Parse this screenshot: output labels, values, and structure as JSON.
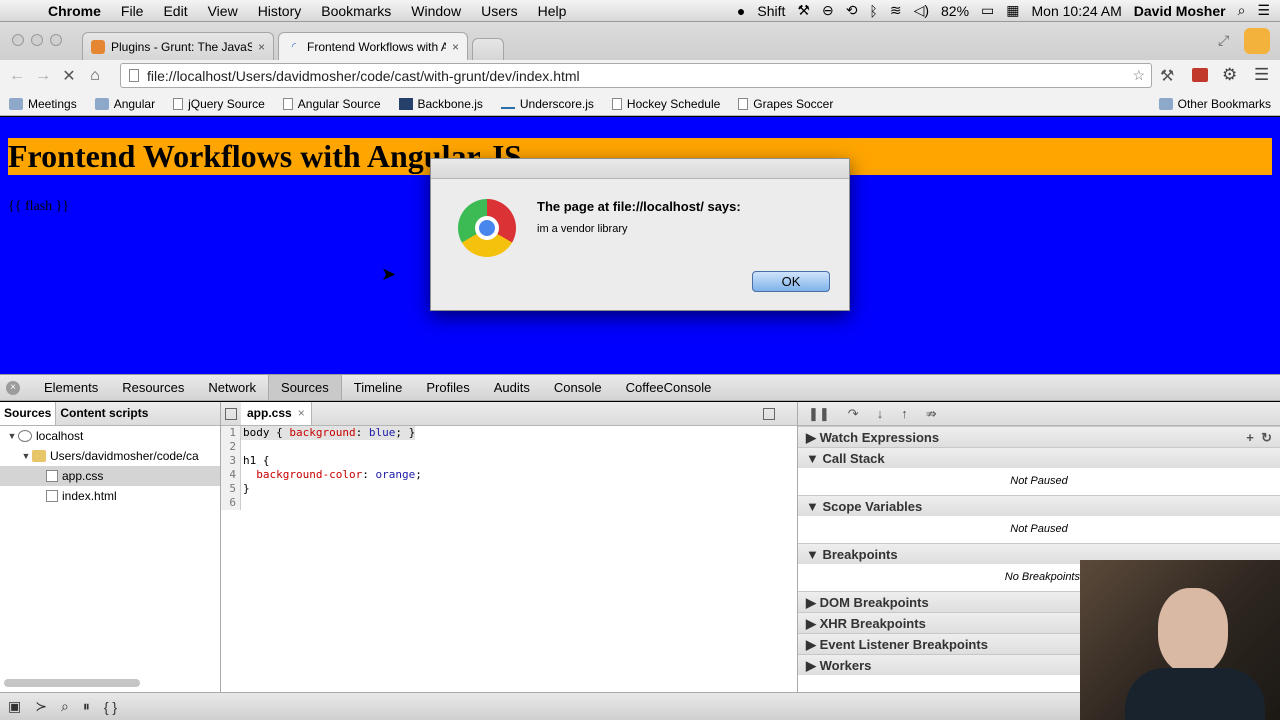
{
  "menubar": {
    "app": "Chrome",
    "items": [
      "File",
      "Edit",
      "View",
      "History",
      "Bookmarks",
      "Window",
      "Users",
      "Help"
    ],
    "status": {
      "shift": "Shift",
      "battery": "82%",
      "clock": "Mon 10:24 AM",
      "user": "David Mosher"
    }
  },
  "tabs": [
    {
      "title": "Plugins - Grunt: The JavaS",
      "active": false
    },
    {
      "title": "Frontend Workflows with A",
      "active": true
    }
  ],
  "omnibox": {
    "url": "file://localhost/Users/davidmosher/code/cast/with-grunt/dev/index.html"
  },
  "bookmarks": [
    "Meetings",
    "Angular",
    "jQuery Source",
    "Angular Source",
    "Backbone.js",
    "Underscore.js",
    "Hockey Schedule",
    "Grapes Soccer"
  ],
  "other_bookmarks": "Other Bookmarks",
  "page": {
    "heading": "Frontend Workflows with Angular JS",
    "flash": "{{ flash }}",
    "bg_color": "#0000fe",
    "h1_color": "#ffa500"
  },
  "alert": {
    "title": "The page at file://localhost/ says:",
    "message": "im a vendor library",
    "ok": "OK"
  },
  "devtools": {
    "tabs": [
      "Elements",
      "Resources",
      "Network",
      "Sources",
      "Timeline",
      "Profiles",
      "Audits",
      "Console",
      "CoffeeConsole"
    ],
    "active_tab": "Sources",
    "nav_tabs": [
      "Sources",
      "Content scripts"
    ],
    "tree": {
      "root": "localhost",
      "folder": "Users/davidmosher/code/ca",
      "files": [
        "app.css",
        "index.html"
      ]
    },
    "editor_tab": "app.css",
    "code": [
      "body { background: blue; }",
      "",
      "h1 {",
      "  background-color: orange;",
      "}",
      ""
    ],
    "sections": [
      {
        "title": "Watch Expressions",
        "expanded": false,
        "body": ""
      },
      {
        "title": "Call Stack",
        "expanded": true,
        "body": "Not Paused"
      },
      {
        "title": "Scope Variables",
        "expanded": true,
        "body": "Not Paused"
      },
      {
        "title": "Breakpoints",
        "expanded": true,
        "body": "No Breakpoints"
      },
      {
        "title": "DOM Breakpoints",
        "expanded": false,
        "body": ""
      },
      {
        "title": "XHR Breakpoints",
        "expanded": false,
        "body": ""
      },
      {
        "title": "Event Listener Breakpoints",
        "expanded": false,
        "body": ""
      },
      {
        "title": "Workers",
        "expanded": false,
        "body": ""
      }
    ]
  }
}
